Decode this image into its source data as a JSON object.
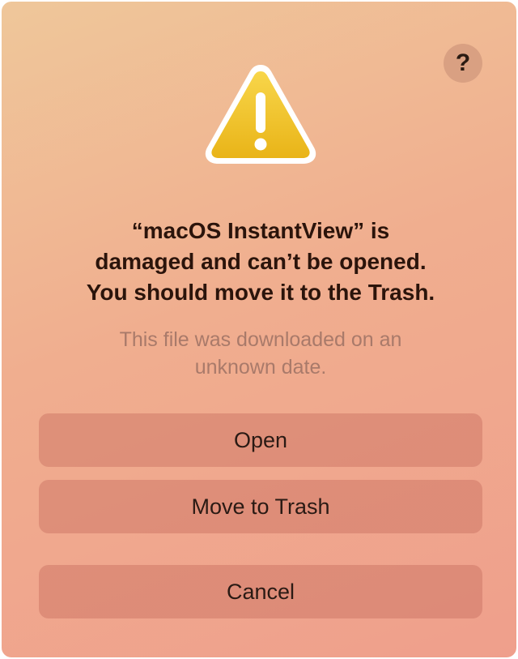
{
  "dialog": {
    "help_label": "?",
    "icon": "warning-triangle-icon",
    "title": "“macOS InstantView” is\ndamaged and can’t be opened.\nYou should move it to the Trash.",
    "subtitle": "This file was downloaded on an\nunknown date.",
    "buttons": {
      "open": "Open",
      "move_to_trash": "Move to Trash",
      "cancel": "Cancel"
    }
  },
  "colors": {
    "background_top": "#efc79a",
    "background_bottom": "#ef9f8c",
    "warning_yellow": "#f2c230",
    "title_text": "#2b140b",
    "subtitle_text": "#a97a6a",
    "button_bg": "#d48a78"
  }
}
